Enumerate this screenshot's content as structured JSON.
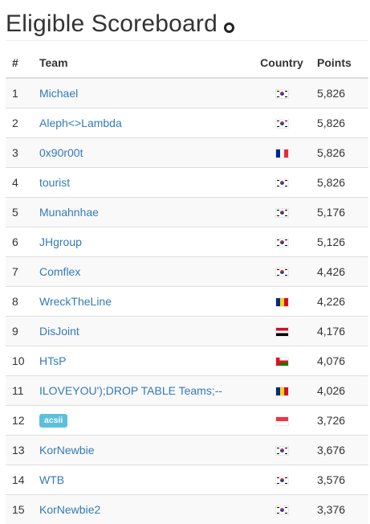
{
  "page": {
    "title": "Eligible Scoreboard"
  },
  "table": {
    "headers": {
      "rank": "#",
      "team": "Team",
      "country": "Country",
      "points": "Points"
    },
    "rows": [
      {
        "rank": "1",
        "team": "Michael",
        "badge": false,
        "flag": "kr",
        "points": "5,826"
      },
      {
        "rank": "2",
        "team": "Aleph<>Lambda",
        "badge": false,
        "flag": "kr",
        "points": "5,826"
      },
      {
        "rank": "3",
        "team": "0x90r00t",
        "badge": false,
        "flag": "fr",
        "points": "5,826"
      },
      {
        "rank": "4",
        "team": "tourist",
        "badge": false,
        "flag": "kr",
        "points": "5,826"
      },
      {
        "rank": "5",
        "team": "Munahnhae",
        "badge": false,
        "flag": "kr",
        "points": "5,176"
      },
      {
        "rank": "6",
        "team": "JHgroup",
        "badge": false,
        "flag": "kr",
        "points": "5,126"
      },
      {
        "rank": "7",
        "team": "Comflex",
        "badge": false,
        "flag": "kr",
        "points": "4,426"
      },
      {
        "rank": "8",
        "team": "WreckTheLine",
        "badge": false,
        "flag": "ro",
        "points": "4,226"
      },
      {
        "rank": "9",
        "team": "DisJoint",
        "badge": false,
        "flag": "ye",
        "points": "4,176"
      },
      {
        "rank": "10",
        "team": "HTsP",
        "badge": false,
        "flag": "om",
        "points": "4,076"
      },
      {
        "rank": "11",
        "team": "ILOVEYOU');DROP TABLE Teams;--",
        "badge": false,
        "flag": "ro",
        "points": "4,026"
      },
      {
        "rank": "12",
        "team": "acsii",
        "badge": true,
        "flag": "sg",
        "points": "3,726"
      },
      {
        "rank": "13",
        "team": "KorNewbie",
        "badge": false,
        "flag": "kr",
        "points": "3,676"
      },
      {
        "rank": "14",
        "team": "WTB",
        "badge": false,
        "flag": "kr",
        "points": "3,576"
      },
      {
        "rank": "15",
        "team": "KorNewbie2",
        "badge": false,
        "flag": "kr",
        "points": "3,376"
      }
    ]
  }
}
